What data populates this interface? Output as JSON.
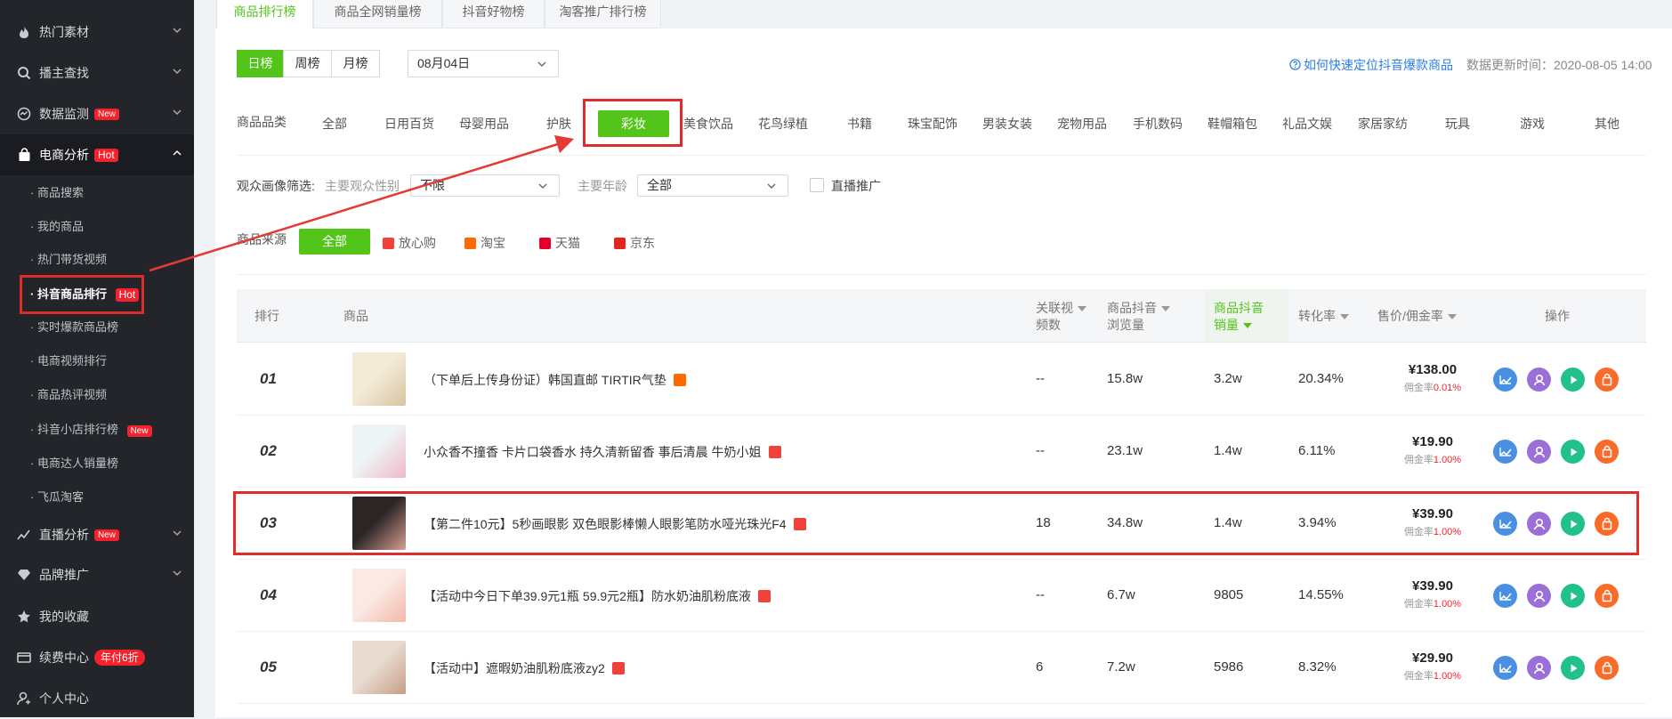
{
  "sidebar": {
    "items": [
      {
        "label": "热门素材",
        "icon": "fire-icon"
      },
      {
        "label": "播主查找",
        "icon": "search-icon"
      },
      {
        "label": "数据监测",
        "icon": "monitor-icon",
        "badge": "New"
      },
      {
        "label": "电商分析",
        "icon": "bag-icon",
        "badge": "Hot"
      },
      {
        "label": "直播分析",
        "icon": "chart-line-icon",
        "badge": "New"
      },
      {
        "label": "品牌推广",
        "icon": "diamond-icon"
      },
      {
        "label": "我的收藏",
        "icon": "star-icon"
      },
      {
        "label": "续费中心",
        "icon": "wallet-icon",
        "badge": "年付6折"
      },
      {
        "label": "个人中心",
        "icon": "user-icon"
      }
    ],
    "sub_items": [
      {
        "label": "· 商品搜索"
      },
      {
        "label": "· 我的商品"
      },
      {
        "label": "· 热门带货视频"
      },
      {
        "label": "· 抖音商品排行",
        "badge": "Hot"
      },
      {
        "label": "· 实时爆款商品榜"
      },
      {
        "label": "· 电商视频排行"
      },
      {
        "label": "· 商品热评视频"
      },
      {
        "label": "· 抖音小店排行榜",
        "badge": "New"
      },
      {
        "label": "· 电商达人销量榜"
      },
      {
        "label": "· 飞瓜淘客"
      }
    ]
  },
  "tabs": [
    "商品排行榜",
    "商品全网销量榜",
    "抖音好物榜",
    "淘客推广排行榜"
  ],
  "period": [
    "日榜",
    "周榜",
    "月榜"
  ],
  "date_value": "08月04日",
  "help_link": "如何快速定位抖音爆款商品",
  "update_time": "数据更新时间：2020-08-05 14:00",
  "category_label": "商品品类",
  "categories": [
    "全部",
    "日用百货",
    "母婴用品",
    "护肤",
    "彩妆",
    "美食饮品",
    "花鸟绿植",
    "书籍",
    "珠宝配饰",
    "男装女装",
    "宠物用品",
    "手机数码",
    "鞋帽箱包",
    "礼品文娱",
    "家居家纺",
    "玩具",
    "游戏",
    "其他"
  ],
  "audience": {
    "label": "观众画像筛选:",
    "gender_label": "主要观众性别",
    "gender_value": "不限",
    "age_label": "主要年龄",
    "age_value": "全部",
    "live_label": "直播推广"
  },
  "source": {
    "label": "商品来源",
    "options": [
      "全部",
      "放心购",
      "淘宝",
      "天猫",
      "京东"
    ]
  },
  "table": {
    "headers": {
      "rank": "排行",
      "product": "商品",
      "videos": [
        "关联视",
        "频数"
      ],
      "views": [
        "商品抖音",
        "浏览量"
      ],
      "sales": [
        "商品抖音",
        "销量"
      ],
      "conv": "转化率",
      "price": "售价/佣金率",
      "ops": "操作"
    },
    "commission_prefix": "佣金率",
    "rows": [
      {
        "rank": "01",
        "name": "（下单后上传身份证）韩国直邮 TIRTIR气垫",
        "src": "taobao",
        "videos": "--",
        "views": "15.8w",
        "sales": "3.2w",
        "conv": "20.34%",
        "price": "¥138.00",
        "commission": "0.01%"
      },
      {
        "rank": "02",
        "name": "小众香不撞香 卡片口袋香水 持久清新留香 事后清晨 牛奶小姐",
        "src": "fangxingou",
        "videos": "--",
        "views": "23.1w",
        "sales": "1.4w",
        "conv": "6.11%",
        "price": "¥19.90",
        "commission": "1.00%"
      },
      {
        "rank": "03",
        "name": "【第二件10元】5秒画眼影 双色眼影棒懒人眼影笔防水哑光珠光F4",
        "src": "fangxingou",
        "videos": "18",
        "views": "34.8w",
        "sales": "1.4w",
        "conv": "3.94%",
        "price": "¥39.90",
        "commission": "1.00%"
      },
      {
        "rank": "04",
        "name": "【活动中今日下单39.9元1瓶 59.9元2瓶】防水奶油肌粉底液",
        "src": "fangxingou",
        "videos": "--",
        "views": "6.7w",
        "sales": "9805",
        "conv": "14.55%",
        "price": "¥39.90",
        "commission": "1.00%"
      },
      {
        "rank": "05",
        "name": "【活动中】遮暇奶油肌粉底液zy2",
        "src": "fangxingou",
        "videos": "6",
        "views": "7.2w",
        "sales": "5986",
        "conv": "8.32%",
        "price": "¥29.90",
        "commission": "1.00%"
      }
    ]
  },
  "colors": {
    "accent": "#52c41a",
    "highlight": "#e02b2b",
    "sidebar": "#23252b"
  }
}
